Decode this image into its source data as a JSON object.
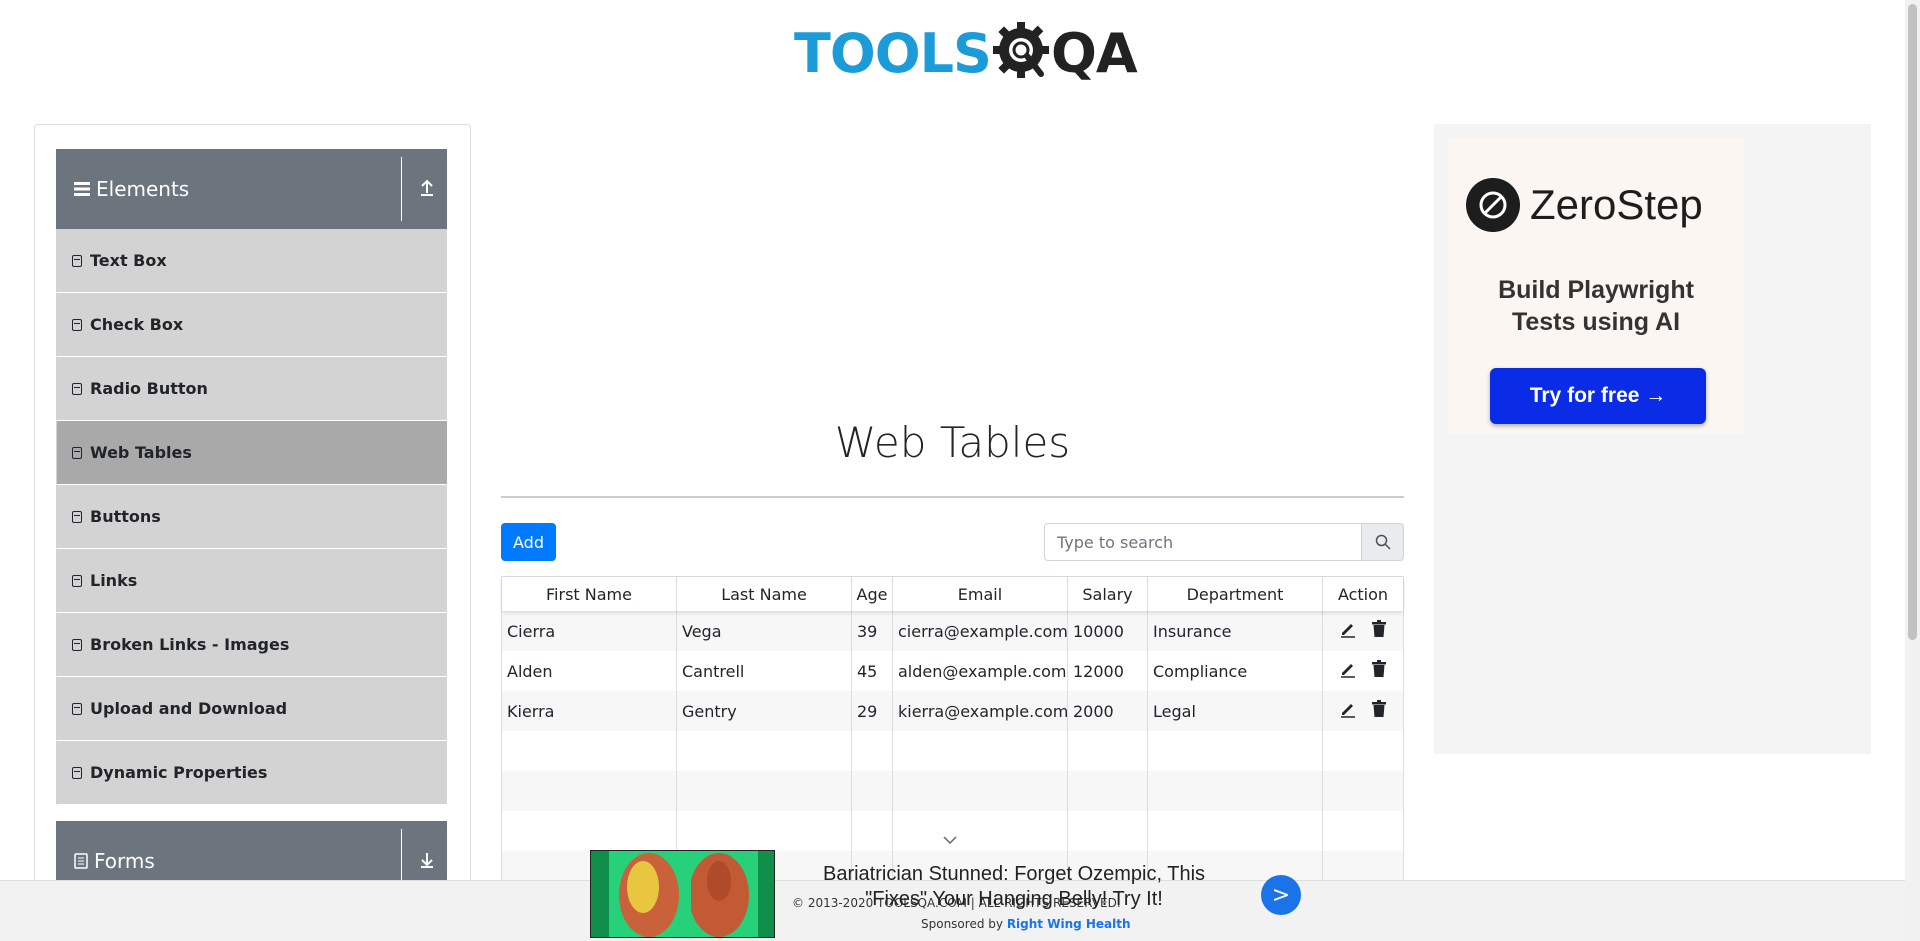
{
  "header": {
    "logo_left": "TOOLS",
    "logo_right": "QA"
  },
  "sidebar": {
    "elements_group": "Elements",
    "forms_group": "Forms",
    "items": [
      {
        "label": "Text Box"
      },
      {
        "label": "Check Box"
      },
      {
        "label": "Radio Button"
      },
      {
        "label": "Web Tables",
        "active": true
      },
      {
        "label": "Buttons"
      },
      {
        "label": "Links"
      },
      {
        "label": "Broken Links - Images"
      },
      {
        "label": "Upload and Download"
      },
      {
        "label": "Dynamic Properties"
      }
    ]
  },
  "main": {
    "title": "Web Tables",
    "add_label": "Add",
    "search_placeholder": "Type to search"
  },
  "table": {
    "headers": [
      "First Name",
      "Last Name",
      "Age",
      "Email",
      "Salary",
      "Department",
      "Action"
    ],
    "rows": [
      [
        "Cierra",
        "Vega",
        "39",
        "cierra@example.com",
        "10000",
        "Insurance"
      ],
      [
        "Alden",
        "Cantrell",
        "45",
        "alden@example.com",
        "12000",
        "Compliance"
      ],
      [
        "Kierra",
        "Gentry",
        "29",
        "kierra@example.com",
        "2000",
        "Legal"
      ],
      [
        "",
        "",
        "",
        "",
        "",
        ""
      ],
      [
        "",
        "",
        "",
        "",
        "",
        ""
      ],
      [
        "",
        "",
        "",
        "",
        "",
        ""
      ],
      [
        "",
        "",
        "",
        "",
        "",
        ""
      ]
    ]
  },
  "right_ad": {
    "brand": "ZeroStep",
    "tagline_1": "Build Playwright",
    "tagline_2": "Tests using AI",
    "cta": "Try for free →"
  },
  "footer": {
    "copyright": "© 2013-2020 TOOLSQA.COM | ALL RIGHTS RESERVED.",
    "sponsored_prefix": "Sponsored by",
    "sponsor_name": "Right Wing Health",
    "ad_headline": "Bariatrician Stunned: Forget Ozempic, This \"Fixes\" Your Hanging Belly! Try It!",
    "ad_next": ">"
  },
  "colors": {
    "accent": "#007bff",
    "sidebar_header": "#6c757d",
    "menu_item": "#d3d3d3",
    "menu_active": "#a9a9a9",
    "logo_blue": "#1b9bd7"
  }
}
